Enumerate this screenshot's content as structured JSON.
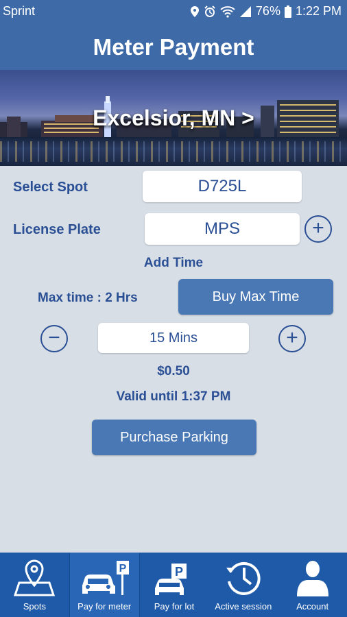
{
  "status": {
    "carrier": "Sprint",
    "battery": "76%",
    "time": "1:22 PM"
  },
  "header": {
    "title": "Meter Payment"
  },
  "banner": {
    "location": "Excelsior, MN >"
  },
  "form": {
    "spot_label": "Select Spot",
    "spot_value": "D725L",
    "plate_label": "License Plate",
    "plate_value": "MPS",
    "add_time_label": "Add Time",
    "max_time_label": "Max time : 2 Hrs",
    "buy_max_label": "Buy Max Time",
    "duration_value": "15 Mins",
    "price": "$0.50",
    "valid_until": "Valid until 1:37 PM",
    "purchase_label": "Purchase Parking"
  },
  "tabs": [
    {
      "label": "Spots",
      "icon": "map-pin-icon"
    },
    {
      "label": "Pay for meter",
      "icon": "car-parking-meter-icon"
    },
    {
      "label": "Pay for lot",
      "icon": "car-parking-lot-icon"
    },
    {
      "label": "Active session",
      "icon": "clock-icon"
    },
    {
      "label": "Account",
      "icon": "person-icon"
    }
  ],
  "colors": {
    "primary": "#3e6aa8",
    "tabbar": "#1f5aa8",
    "text": "#2a4f94",
    "background": "#d7dee6"
  }
}
